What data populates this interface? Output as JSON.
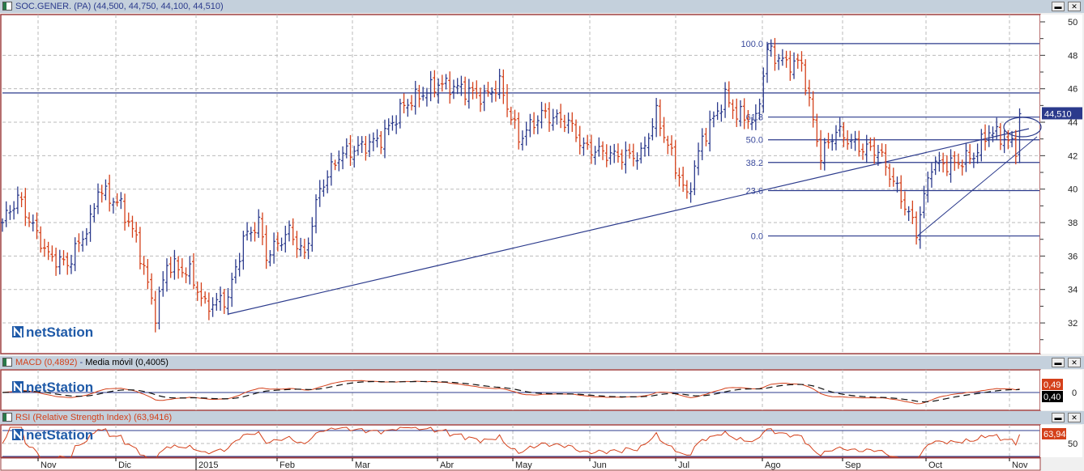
{
  "main_panel": {
    "title": "SOC.GENER. (PA) (44,500, 44,750, 44,100, 44,510)",
    "last_price_badge": "44,510",
    "y_ticks": [
      "50",
      "48",
      "46",
      "44",
      "42",
      "40",
      "38",
      "36",
      "34",
      "32"
    ],
    "fib_labels": [
      "100.0",
      "61.8",
      "50.0",
      "38.2",
      "23.6",
      "0.0"
    ]
  },
  "macd_panel": {
    "title_macd": "MACD (0,4892)",
    "separator": " - ",
    "title_ma": "Media móvil (0,4005)",
    "badge_macd": "0,49",
    "badge_ma": "0,40",
    "y_tick": "0"
  },
  "rsi_panel": {
    "title": "RSI (Relative Strength Index) (63,9416)",
    "badge": "63,94",
    "y_tick": "50"
  },
  "x_axis": {
    "labels": [
      "Nov",
      "Dic",
      "2015",
      "Feb",
      "Mar",
      "Abr",
      "May",
      "Jun",
      "Jul",
      "Ago",
      "Sep",
      "Oct",
      "Nov"
    ]
  },
  "logo": {
    "text": "netStation"
  },
  "window_buttons": {
    "minimize": "▬",
    "close": "✕"
  },
  "colors": {
    "up": "#2b3a8c",
    "down": "#d4401a",
    "line": "#2b3a8c",
    "macd": "#d4401a",
    "signal": "#111111"
  },
  "chart_data": {
    "type": "ohlc",
    "title": "SOC.GENER. (PA)",
    "ylim": [
      31,
      50.5
    ],
    "key_points": [
      [
        0,
        38
      ],
      [
        4,
        39.5
      ],
      [
        12,
        36
      ],
      [
        17,
        35.5
      ],
      [
        23,
        38
      ],
      [
        25,
        40
      ],
      [
        31,
        39
      ],
      [
        35,
        37
      ],
      [
        40,
        32.5
      ],
      [
        43,
        35.5
      ],
      [
        49,
        35
      ],
      [
        53,
        33
      ],
      [
        59,
        33.5
      ],
      [
        63,
        37
      ],
      [
        67,
        38
      ],
      [
        69,
        36
      ],
      [
        75,
        37.5
      ],
      [
        79,
        36
      ],
      [
        83,
        40
      ],
      [
        88,
        42
      ],
      [
        99,
        43
      ],
      [
        105,
        45
      ],
      [
        114,
        46.3
      ],
      [
        120,
        46
      ],
      [
        126,
        45.5
      ],
      [
        130,
        46.3
      ],
      [
        135,
        43
      ],
      [
        141,
        44.5
      ],
      [
        148,
        44
      ],
      [
        152,
        42.5
      ],
      [
        160,
        42
      ],
      [
        167,
        42
      ],
      [
        171,
        44.5
      ],
      [
        175,
        42
      ],
      [
        179,
        39.5
      ],
      [
        183,
        43
      ],
      [
        189,
        45.5
      ],
      [
        192,
        44.5
      ],
      [
        197,
        44
      ],
      [
        200,
        48.3
      ],
      [
        205,
        47.5
      ],
      [
        209,
        47.5
      ],
      [
        212,
        44
      ],
      [
        214,
        42
      ],
      [
        218,
        43.5
      ],
      [
        224,
        42.5
      ],
      [
        229,
        42.3
      ],
      [
        235,
        39.5
      ],
      [
        239,
        37.5
      ],
      [
        243,
        41.5
      ],
      [
        249,
        41.5
      ],
      [
        254,
        42
      ],
      [
        258,
        43.5
      ],
      [
        262,
        43
      ],
      [
        265,
        42.5
      ],
      [
        266,
        44.51
      ]
    ],
    "fibonacci": {
      "high": 48.7,
      "low": 37.2,
      "levels": [
        100.0,
        61.8,
        50.0,
        38.2,
        23.6,
        0.0
      ]
    },
    "horizontal_line": 45.75,
    "macd": {
      "value": 0.4892,
      "signal": 0.4005
    },
    "rsi": {
      "value": 63.9416,
      "levels": [
        70,
        30
      ]
    }
  }
}
